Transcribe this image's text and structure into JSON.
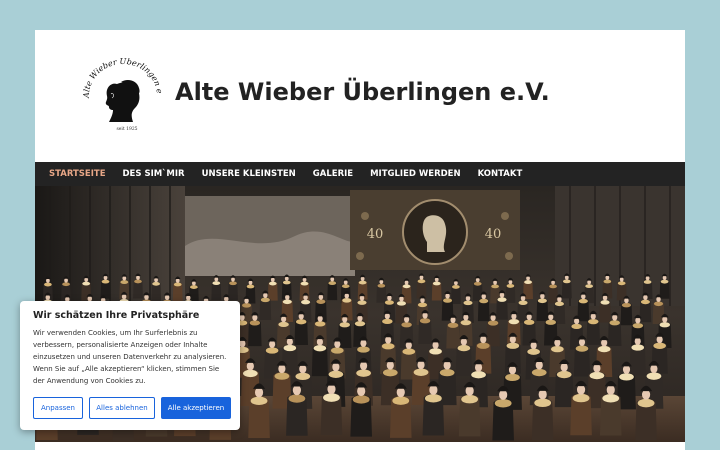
{
  "site": {
    "title": "Alte Wieber Überlingen e.V.",
    "logo_text": "Alte Wieber Überlingen e.V.",
    "logo_small": "seit 1925"
  },
  "nav": {
    "items": [
      {
        "label": "STARTSEITE",
        "active": true
      },
      {
        "label": "DES SIM`MIR",
        "active": false
      },
      {
        "label": "UNSERE KLEINSTEN",
        "active": false
      },
      {
        "label": "GALERIE",
        "active": false
      },
      {
        "label": "MITGLIED WERDEN",
        "active": false
      },
      {
        "label": "KONTAKT",
        "active": false
      }
    ],
    "active_color": "#e8a787"
  },
  "hero": {
    "banner_numbers": [
      "40",
      "40"
    ]
  },
  "cookie": {
    "title": "Wir schätzen Ihre Privatsphäre",
    "text": "Wir verwenden Cookies, um Ihr Surferlebnis zu verbessern, personalisierte Anzeigen oder Inhalte einzusetzen und unseren Datenverkehr zu analysieren. Wenn Sie auf „Alle akzeptieren“ klicken, stimmen Sie der Anwendung von Cookies zu.",
    "buttons": {
      "customize": "Anpassen",
      "reject": "Alles ablehnen",
      "accept": "Alle akzeptieren"
    },
    "accent_color": "#1863dc"
  },
  "colors": {
    "background": "#a9cfd6",
    "nav_bg": "#232323"
  }
}
